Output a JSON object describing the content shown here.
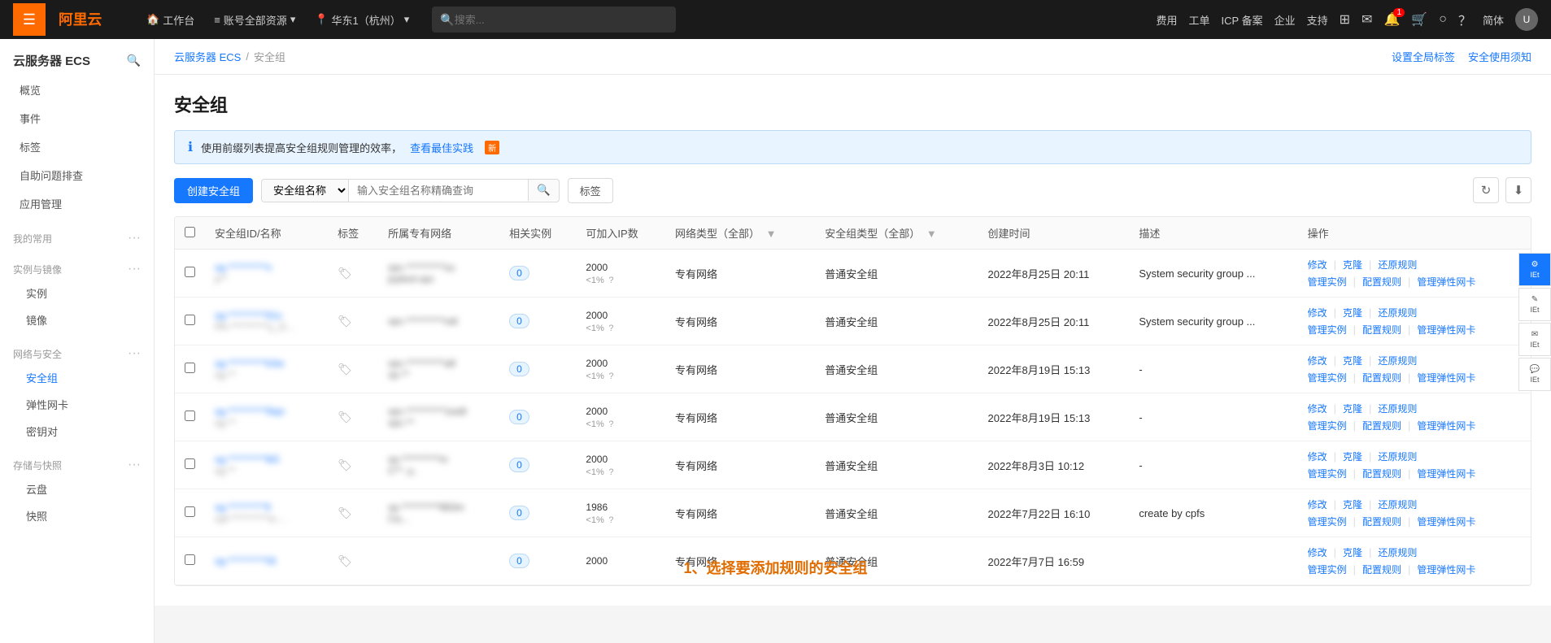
{
  "app": {
    "title": "阿里云"
  },
  "topnav": {
    "menu_label": "≡",
    "workbench": "工作台",
    "account_resources": "账号全部资源",
    "region": "华东1（杭州）",
    "search_placeholder": "搜索...",
    "cost": "费用",
    "tools": "工单",
    "icp": "ICP 备案",
    "enterprise": "企业",
    "support": "支持",
    "lang": "简体"
  },
  "sidebar": {
    "title": "云服务器 ECS",
    "items": [
      {
        "label": "概览",
        "active": false
      },
      {
        "label": "事件",
        "active": false
      },
      {
        "label": "标签",
        "active": false
      },
      {
        "label": "自助问题排查",
        "active": false
      },
      {
        "label": "应用管理",
        "active": false
      }
    ],
    "sections": [
      {
        "label": "我的常用",
        "items": []
      },
      {
        "label": "实例与镜像",
        "items": [
          {
            "label": "实例",
            "active": false
          },
          {
            "label": "镜像",
            "active": false
          }
        ]
      },
      {
        "label": "网络与安全",
        "items": [
          {
            "label": "安全组",
            "active": true
          },
          {
            "label": "弹性网卡",
            "active": false
          },
          {
            "label": "密钥对",
            "active": false
          }
        ]
      },
      {
        "label": "存储与快照",
        "items": [
          {
            "label": "云盘",
            "active": false
          },
          {
            "label": "快照",
            "active": false
          }
        ]
      }
    ]
  },
  "breadcrumb": {
    "parent": "云服务器 ECS",
    "separator": "/",
    "current": "安全组",
    "actions": [
      {
        "label": "设置全局标签"
      },
      {
        "label": "安全使用须知"
      }
    ]
  },
  "page": {
    "title": "安全组"
  },
  "info_banner": {
    "text": "使用前缀列表提高安全组规则管理的效率，",
    "link_text": "查看最佳实践",
    "tag": "新"
  },
  "toolbar": {
    "create_btn": "创建安全组",
    "filter_label": "安全组名称",
    "search_placeholder": "输入安全组名称精确查询",
    "tag_btn": "标签",
    "refresh_icon": "↻",
    "download_icon": "⬇"
  },
  "table": {
    "columns": [
      {
        "label": ""
      },
      {
        "label": "安全组ID/名称"
      },
      {
        "label": "标签"
      },
      {
        "label": "所属专有网络"
      },
      {
        "label": "相关实例"
      },
      {
        "label": "可加入IP数"
      },
      {
        "label": "网络类型（全部）",
        "filterable": true
      },
      {
        "label": "安全组类型（全部）",
        "filterable": true
      },
      {
        "label": "创建时间"
      },
      {
        "label": "描述"
      },
      {
        "label": "操作"
      }
    ],
    "rows": [
      {
        "id": "sg-**********n",
        "name": "p**",
        "vpc": "vpc-**********zu\njsytest-vpc",
        "instances": "0",
        "ip_count": "2000",
        "ip_percent": "<1%",
        "network_type": "专有网络",
        "sg_type": "普通安全组",
        "created": "2022年8月25日 20:11",
        "desc": "System security group ...",
        "actions": [
          "修改",
          "克隆",
          "还原规则",
          "管理实例",
          "配置规则",
          "管理弹性网卡"
        ]
      },
      {
        "id": "sg-**********tl1o",
        "name": "PA-**********y_G...",
        "vpc": "vpc-**********odi",
        "instances": "0",
        "ip_count": "2000",
        "ip_percent": "<1%",
        "network_type": "专有网络",
        "sg_type": "普通安全组",
        "created": "2022年8月25日 20:11",
        "desc": "System security group ...",
        "actions": [
          "修改",
          "克隆",
          "还原规则",
          "管理实例",
          "配置规则",
          "管理弹性网卡"
        ]
      },
      {
        "id": "sg-**********b3w",
        "name": "sg-**",
        "vpc": "vpc-**********a9\nvp-**",
        "instances": "0",
        "ip_count": "2000",
        "ip_percent": "<1%",
        "network_type": "专有网络",
        "sg_type": "普通安全组",
        "created": "2022年8月19日 15:13",
        "desc": "-",
        "actions": [
          "修改",
          "克隆",
          "还原规则",
          "管理实例",
          "配置规则",
          "管理弹性网卡"
        ]
      },
      {
        "id": "sg-**********5lqn",
        "name": "sg-**",
        "vpc": "vpc-**********1ea9\nvpc-**",
        "instances": "0",
        "ip_count": "2000",
        "ip_percent": "<1%",
        "network_type": "专有网络",
        "sg_type": "普通安全组",
        "created": "2022年8月19日 15:13",
        "desc": "-",
        "actions": [
          "修改",
          "克隆",
          "还原规则",
          "管理实例",
          "配置规则",
          "管理弹性网卡"
        ]
      },
      {
        "id": "sg-**********lb5",
        "name": "sg-**",
        "vpc": "vp-**********m\nC**..y..",
        "instances": "0",
        "ip_count": "2000",
        "ip_percent": "<1%",
        "network_type": "专有网络",
        "sg_type": "普通安全组",
        "created": "2022年8月3日 10:12",
        "desc": "-",
        "actions": [
          "修改",
          "克隆",
          "还原规则",
          "管理实例",
          "配置规则",
          "管理弹性网卡"
        ]
      },
      {
        "id": "sg-**********ll",
        "name": "cpf-**********a-...",
        "vpc": "vp-**********963m\nCa...",
        "instances": "0",
        "ip_count": "1986",
        "ip_percent": "<1%",
        "network_type": "专有网络",
        "sg_type": "普通安全组",
        "created": "2022年7月22日 16:10",
        "desc": "create by cpfs",
        "actions": [
          "修改",
          "克隆",
          "还原规则",
          "管理实例",
          "配置规则",
          "管理弹性网卡"
        ]
      },
      {
        "id": "sg-**********l3i",
        "name": "",
        "vpc": "",
        "instances": "0",
        "ip_count": "2000",
        "ip_percent": "",
        "network_type": "专有网络",
        "sg_type": "普通安全组",
        "created": "2022年7月7日 16:59",
        "desc": "",
        "actions": [
          "修改",
          "克隆",
          "还原规则",
          "管理实例",
          "配置规则",
          "管理弹性网卡"
        ]
      }
    ]
  },
  "annotation": {
    "text": "1、选择要添加规则的安全组"
  },
  "side_buttons": [
    {
      "icon": "✎",
      "label": "IEt"
    },
    {
      "icon": "✉",
      "label": "IEt"
    },
    {
      "icon": "💬",
      "label": "IEt"
    },
    {
      "icon": "⚙",
      "label": "IEt"
    }
  ]
}
